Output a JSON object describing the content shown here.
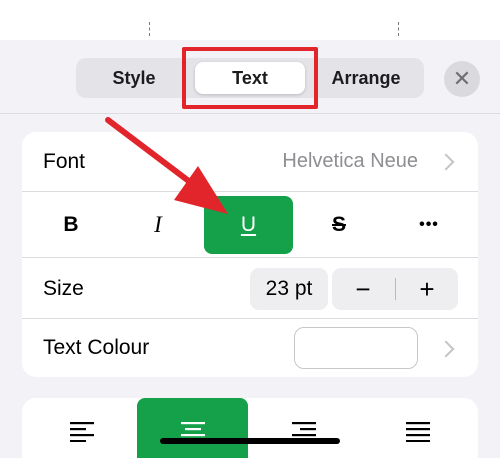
{
  "tabs": {
    "items": [
      {
        "label": "Style"
      },
      {
        "label": "Text"
      },
      {
        "label": "Arrange"
      }
    ],
    "selected": "Text",
    "close_icon": "close-icon"
  },
  "text_settings": {
    "font": {
      "label": "Font",
      "value": "Helvetica Neue"
    },
    "styles": [
      {
        "glyph": "B",
        "name": "bold"
      },
      {
        "glyph": "I",
        "name": "italic"
      },
      {
        "glyph": "U",
        "name": "underline",
        "active": true
      },
      {
        "glyph": "S",
        "name": "strikethrough"
      },
      {
        "glyph": "•••",
        "name": "more"
      }
    ],
    "size": {
      "label": "Size",
      "value": "23 pt",
      "decrement": "−",
      "increment": "+"
    },
    "colour": {
      "label": "Text Colour",
      "swatch": "#ffffff"
    }
  },
  "alignment": {
    "options": [
      "left",
      "center",
      "right",
      "justify"
    ],
    "selected": "center"
  },
  "colors": {
    "accent_green": "#14a14a",
    "annotation_red": "#e2242b",
    "panel_bg": "#f2f2f7"
  }
}
